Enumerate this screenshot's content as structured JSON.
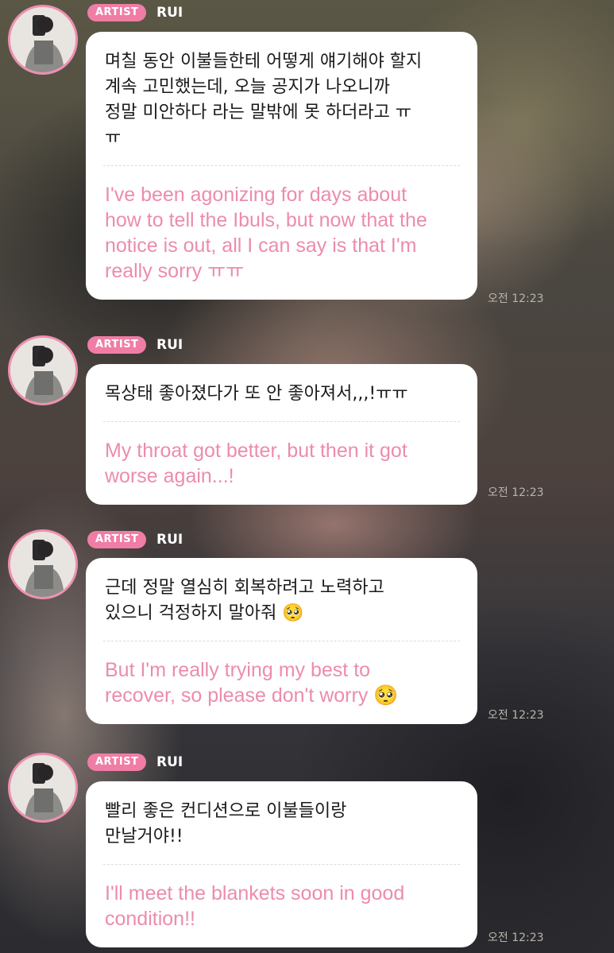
{
  "messages": [
    {
      "badge": "ARTIST",
      "author": "RUI",
      "text_ko": "며칠 동안 이불들한테 어떻게 얘기해야 할지\n계속 고민했는데, 오늘 공지가 나오니까\n정말 미안하다 라는 말밖에 못 하더라고 ㅠ\nㅠ",
      "text_en": "I've been agonizing for days about\nhow to tell the Ibuls, but now that the\nnotice is out, all I can say is that I'm\nreally sorry ㅠㅠ",
      "time": "오전 12:23"
    },
    {
      "badge": "ARTIST",
      "author": "RUI",
      "text_ko": "목상태 좋아졌다가 또 안 좋아져서,,,!ㅠㅠ",
      "text_en": "My throat got better, but then it got\nworse again...!",
      "time": "오전 12:23"
    },
    {
      "badge": "ARTIST",
      "author": "RUI",
      "text_ko": "근데 정말 열심히 회복하려고 노력하고\n있으니 걱정하지 말아줘 🥺",
      "text_en": "But I'm really trying my best to\nrecover, so please don't worry 🥺",
      "time": "오전 12:23"
    },
    {
      "badge": "ARTIST",
      "author": "RUI",
      "text_ko": "빨리 좋은 컨디션으로 이불들이랑\n만날거야!!",
      "text_en": "I'll meet the blankets soon in good\ncondition!!",
      "time": "오전 12:23"
    }
  ],
  "colors": {
    "badge": "#f07da5",
    "avatar_ring": "#ee8fb2",
    "translation_text": "#ec8cab",
    "bubble": "#ffffff"
  },
  "icons": [
    "artist-avatar-icon"
  ]
}
